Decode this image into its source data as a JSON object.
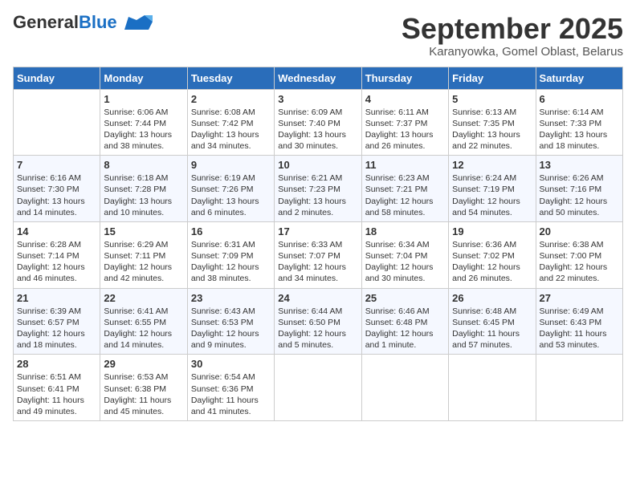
{
  "header": {
    "logo_general": "General",
    "logo_blue": "Blue",
    "month": "September 2025",
    "location": "Karanyowka, Gomel Oblast, Belarus"
  },
  "days_of_week": [
    "Sunday",
    "Monday",
    "Tuesday",
    "Wednesday",
    "Thursday",
    "Friday",
    "Saturday"
  ],
  "weeks": [
    [
      {
        "day": "",
        "info": ""
      },
      {
        "day": "1",
        "info": "Sunrise: 6:06 AM\nSunset: 7:44 PM\nDaylight: 13 hours\nand 38 minutes."
      },
      {
        "day": "2",
        "info": "Sunrise: 6:08 AM\nSunset: 7:42 PM\nDaylight: 13 hours\nand 34 minutes."
      },
      {
        "day": "3",
        "info": "Sunrise: 6:09 AM\nSunset: 7:40 PM\nDaylight: 13 hours\nand 30 minutes."
      },
      {
        "day": "4",
        "info": "Sunrise: 6:11 AM\nSunset: 7:37 PM\nDaylight: 13 hours\nand 26 minutes."
      },
      {
        "day": "5",
        "info": "Sunrise: 6:13 AM\nSunset: 7:35 PM\nDaylight: 13 hours\nand 22 minutes."
      },
      {
        "day": "6",
        "info": "Sunrise: 6:14 AM\nSunset: 7:33 PM\nDaylight: 13 hours\nand 18 minutes."
      }
    ],
    [
      {
        "day": "7",
        "info": "Sunrise: 6:16 AM\nSunset: 7:30 PM\nDaylight: 13 hours\nand 14 minutes."
      },
      {
        "day": "8",
        "info": "Sunrise: 6:18 AM\nSunset: 7:28 PM\nDaylight: 13 hours\nand 10 minutes."
      },
      {
        "day": "9",
        "info": "Sunrise: 6:19 AM\nSunset: 7:26 PM\nDaylight: 13 hours\nand 6 minutes."
      },
      {
        "day": "10",
        "info": "Sunrise: 6:21 AM\nSunset: 7:23 PM\nDaylight: 13 hours\nand 2 minutes."
      },
      {
        "day": "11",
        "info": "Sunrise: 6:23 AM\nSunset: 7:21 PM\nDaylight: 12 hours\nand 58 minutes."
      },
      {
        "day": "12",
        "info": "Sunrise: 6:24 AM\nSunset: 7:19 PM\nDaylight: 12 hours\nand 54 minutes."
      },
      {
        "day": "13",
        "info": "Sunrise: 6:26 AM\nSunset: 7:16 PM\nDaylight: 12 hours\nand 50 minutes."
      }
    ],
    [
      {
        "day": "14",
        "info": "Sunrise: 6:28 AM\nSunset: 7:14 PM\nDaylight: 12 hours\nand 46 minutes."
      },
      {
        "day": "15",
        "info": "Sunrise: 6:29 AM\nSunset: 7:11 PM\nDaylight: 12 hours\nand 42 minutes."
      },
      {
        "day": "16",
        "info": "Sunrise: 6:31 AM\nSunset: 7:09 PM\nDaylight: 12 hours\nand 38 minutes."
      },
      {
        "day": "17",
        "info": "Sunrise: 6:33 AM\nSunset: 7:07 PM\nDaylight: 12 hours\nand 34 minutes."
      },
      {
        "day": "18",
        "info": "Sunrise: 6:34 AM\nSunset: 7:04 PM\nDaylight: 12 hours\nand 30 minutes."
      },
      {
        "day": "19",
        "info": "Sunrise: 6:36 AM\nSunset: 7:02 PM\nDaylight: 12 hours\nand 26 minutes."
      },
      {
        "day": "20",
        "info": "Sunrise: 6:38 AM\nSunset: 7:00 PM\nDaylight: 12 hours\nand 22 minutes."
      }
    ],
    [
      {
        "day": "21",
        "info": "Sunrise: 6:39 AM\nSunset: 6:57 PM\nDaylight: 12 hours\nand 18 minutes."
      },
      {
        "day": "22",
        "info": "Sunrise: 6:41 AM\nSunset: 6:55 PM\nDaylight: 12 hours\nand 14 minutes."
      },
      {
        "day": "23",
        "info": "Sunrise: 6:43 AM\nSunset: 6:53 PM\nDaylight: 12 hours\nand 9 minutes."
      },
      {
        "day": "24",
        "info": "Sunrise: 6:44 AM\nSunset: 6:50 PM\nDaylight: 12 hours\nand 5 minutes."
      },
      {
        "day": "25",
        "info": "Sunrise: 6:46 AM\nSunset: 6:48 PM\nDaylight: 12 hours\nand 1 minute."
      },
      {
        "day": "26",
        "info": "Sunrise: 6:48 AM\nSunset: 6:45 PM\nDaylight: 11 hours\nand 57 minutes."
      },
      {
        "day": "27",
        "info": "Sunrise: 6:49 AM\nSunset: 6:43 PM\nDaylight: 11 hours\nand 53 minutes."
      }
    ],
    [
      {
        "day": "28",
        "info": "Sunrise: 6:51 AM\nSunset: 6:41 PM\nDaylight: 11 hours\nand 49 minutes."
      },
      {
        "day": "29",
        "info": "Sunrise: 6:53 AM\nSunset: 6:38 PM\nDaylight: 11 hours\nand 45 minutes."
      },
      {
        "day": "30",
        "info": "Sunrise: 6:54 AM\nSunset: 6:36 PM\nDaylight: 11 hours\nand 41 minutes."
      },
      {
        "day": "",
        "info": ""
      },
      {
        "day": "",
        "info": ""
      },
      {
        "day": "",
        "info": ""
      },
      {
        "day": "",
        "info": ""
      }
    ]
  ]
}
